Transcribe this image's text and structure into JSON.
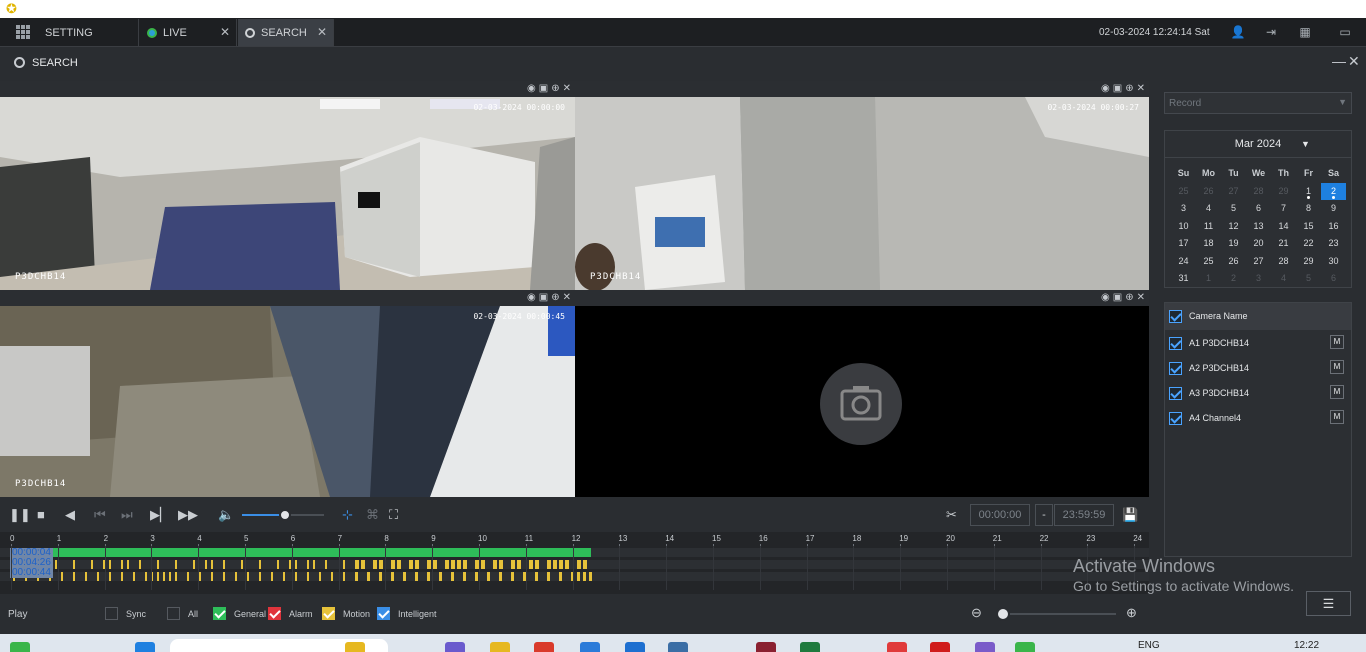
{
  "top_bar": {
    "tabs": [
      {
        "label": "SETTING"
      },
      {
        "label": "LIVE"
      },
      {
        "label": "SEARCH"
      }
    ],
    "datetime": "02-03-2024 12:24:14 Sat"
  },
  "module": {
    "title": "SEARCH",
    "minimize": "—",
    "close": "✕"
  },
  "video_panes": [
    {
      "camera_label": "P3DCHB14",
      "osd_time": "02-03-2024 00:00:00"
    },
    {
      "camera_label": "P3DCHB14",
      "osd_time": "02-03-2024 00:00:27"
    },
    {
      "camera_label": "P3DCHB14",
      "osd_time": "02-03-2024 00:00:45"
    },
    {
      "camera_label": "",
      "osd_time": ""
    }
  ],
  "controls": {
    "start_time": "00:00:00",
    "separator": "-",
    "end_time": "23:59:59",
    "volume_level": 0.52
  },
  "timeline": {
    "hour_labels": [
      "0",
      "1",
      "2",
      "3",
      "4",
      "5",
      "6",
      "7",
      "8",
      "9",
      "10",
      "11",
      "12",
      "13",
      "14",
      "15",
      "16",
      "17",
      "18",
      "19",
      "20",
      "21",
      "22",
      "23",
      "24"
    ],
    "row_times": [
      "00:00:04",
      "00:04:26",
      "00:00:44"
    ],
    "recorded_until_hour": 12.4
  },
  "legend": {
    "play_label": "Play",
    "items": [
      {
        "label": "Sync",
        "checked": false,
        "color": "#2a2d31"
      },
      {
        "label": "All",
        "checked": false,
        "color": "#2a2d31"
      },
      {
        "label": "General",
        "checked": true,
        "color": "#2ebd59"
      },
      {
        "label": "Alarm",
        "checked": true,
        "color": "#e0343c"
      },
      {
        "label": "Motion",
        "checked": true,
        "color": "#e6c23a"
      },
      {
        "label": "Intelligent",
        "checked": true,
        "color": "#3a8ee6"
      }
    ]
  },
  "right_panel": {
    "record_type": {
      "placeholder": "Record"
    },
    "calendar": {
      "month_label": "Mar 2024",
      "weekdays": [
        "Su",
        "Mo",
        "Tu",
        "We",
        "Th",
        "Fr",
        "Sa"
      ],
      "days": [
        {
          "d": "25",
          "m": true
        },
        {
          "d": "26",
          "m": true
        },
        {
          "d": "27",
          "m": true
        },
        {
          "d": "28",
          "m": true
        },
        {
          "d": "29",
          "m": true
        },
        {
          "d": "1",
          "dot": true
        },
        {
          "d": "2",
          "sel": true,
          "dot": true
        },
        {
          "d": "3"
        },
        {
          "d": "4"
        },
        {
          "d": "5"
        },
        {
          "d": "6"
        },
        {
          "d": "7"
        },
        {
          "d": "8"
        },
        {
          "d": "9"
        },
        {
          "d": "10"
        },
        {
          "d": "11"
        },
        {
          "d": "12"
        },
        {
          "d": "13"
        },
        {
          "d": "14"
        },
        {
          "d": "15"
        },
        {
          "d": "16"
        },
        {
          "d": "17"
        },
        {
          "d": "18"
        },
        {
          "d": "19"
        },
        {
          "d": "20"
        },
        {
          "d": "21"
        },
        {
          "d": "22"
        },
        {
          "d": "23"
        },
        {
          "d": "24"
        },
        {
          "d": "25"
        },
        {
          "d": "26"
        },
        {
          "d": "27"
        },
        {
          "d": "28"
        },
        {
          "d": "29"
        },
        {
          "d": "30"
        },
        {
          "d": "31"
        },
        {
          "d": "1",
          "m": true
        },
        {
          "d": "2",
          "m": true
        },
        {
          "d": "3",
          "m": true
        },
        {
          "d": "4",
          "m": true
        },
        {
          "d": "5",
          "m": true
        },
        {
          "d": "6",
          "m": true
        }
      ]
    },
    "camera_list": {
      "header": "Camera Name",
      "cameras": [
        {
          "name": "A1 P3DCHB14",
          "mode": "M"
        },
        {
          "name": "A2 P3DCHB14",
          "mode": "M"
        },
        {
          "name": "A3 P3DCHB14",
          "mode": "M"
        },
        {
          "name": "A4 Channel4",
          "mode": "M"
        }
      ]
    }
  },
  "watermark": {
    "line1": "Activate Windows",
    "line2": "Go to Settings to activate Windows."
  },
  "taskbar": {
    "lang": "ENG",
    "clock": "12:22"
  }
}
